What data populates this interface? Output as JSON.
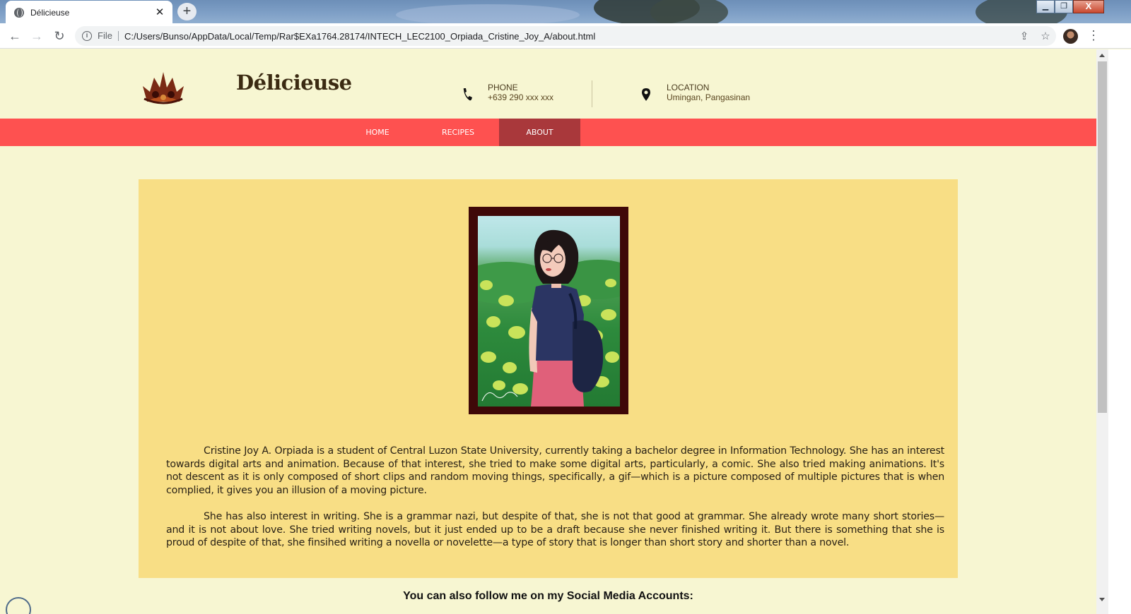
{
  "browser": {
    "tab_title": "Délicieuse",
    "tab_close": "✕",
    "new_tab": "+",
    "file_label": "File",
    "url": "C:/Users/Bunso/AppData/Local/Temp/Rar$EXa1764.28174/INTECH_LEC2100_Orpiada_Cristine_Joy_A/about.html",
    "window_controls": [
      "▁",
      "❐",
      "X"
    ]
  },
  "header": {
    "brand": "Délicieuse",
    "phone_label": "PHONE",
    "phone_value": "+639 290 xxx xxx",
    "location_label": "LOCATION",
    "location_value": "Umingan, Pangasinan"
  },
  "nav": {
    "home": "HOME",
    "recipes": "RECIPES",
    "about": "ABOUT",
    "active": "about"
  },
  "about": {
    "paragraph_1": "Cristine Joy A. Orpiada is a student of Central Luzon State University, currently taking a bachelor degree in Information Technology. She has an interest towards digital arts and animation. Because of that interest, she tried to make some digital arts, particularly, a comic. She also tried making animations. It's not descent as it is only composed of short clips and random moving things, specifically, a gif—which is a picture composed of multiple pictures that is when complied, it gives you an illusion of a moving picture.",
    "paragraph_2": "She has also interest in writing. She is a grammar nazi, but despite of that, she is not that good at grammar. She already wrote many short stories—and it is not about love. She tried writing novels, but it just ended up to be a draft because she never finished writing it. But there is something that she is proud of despite of that, she finsihed writing a novella or novelette—a type of story that is longer than short story and shorter than a novel."
  },
  "social": {
    "heading": "You can also follow me on my Social Media Accounts:"
  },
  "colors": {
    "page_bg": "#f7f6d2",
    "nav_bg": "#fe5150",
    "nav_active": "#a9383b",
    "panel_bg": "#f8de85",
    "frame": "#3f0808"
  }
}
